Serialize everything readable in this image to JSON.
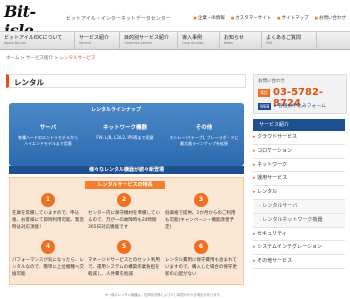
{
  "header": {
    "logo_text": "Bit-isle",
    "logo_sub": "internet data center",
    "tagline": "ビットアイル・インターネットデータセンター",
    "util_nav": [
      "企業・IR情報",
      "カスタマーサイト",
      "サイトマップ",
      "お問い合わせ"
    ]
  },
  "main_nav": [
    {
      "ja": "ビットアイルIDCについて",
      "en": "About Bit-isle"
    },
    {
      "ja": "サービス紹介",
      "en": "Service"
    },
    {
      "ja": "目的別サービス紹介",
      "en": "Objective Search"
    },
    {
      "ja": "導入事例",
      "en": "Case Studies"
    },
    {
      "ja": "お知らせ",
      "en": "News"
    },
    {
      "ja": "よくあるご質問",
      "en": "FAQ"
    }
  ],
  "breadcrumb": {
    "home": "ホーム",
    "sep1": " > ",
    "parent": "サービス紹介",
    "sep2": " > ",
    "current": "レンタルサービス"
  },
  "page_title": "レンタル",
  "lineup": {
    "title": "レンタルラインナップ",
    "columns": [
      {
        "heading": "サーバ",
        "desc": "各種ハードのエントリモデルから\nハイエンドモデルまで用意"
      },
      {
        "heading": "ネットワーク機器",
        "desc": "FW, L/B, L3/L2, IPS等まで用意"
      },
      {
        "heading": "その他",
        "desc": "ストレージ(テープ), プレーラボ・ドに\n最大限ラインナップを拡張"
      }
    ],
    "banner": "様々なレンタル機器が続々新登場"
  },
  "features": {
    "title": "レンタルサービスの特長",
    "items": [
      {
        "num": "1",
        "text": "在庫を常備していますので、申込後、お客様にて即時利用可能、緊急時は対応頂能！"
      },
      {
        "num": "2",
        "text": "センター内に保守機材を準備しているので、万が一の故障時も24時間365日対応機能です"
      },
      {
        "num": "3",
        "text": "低価格で提供。1か月からのご利用も可能(キャンペーン・機能改善予定)"
      },
      {
        "num": "4",
        "text": "パフォーマンスが気になったら、レンタルなので、簡単に上位機種へ交換可能"
      },
      {
        "num": "5",
        "text": "マネージドサービスとのセット利用で、運用システムの構築作業負担を軽減し、人件費を削減"
      },
      {
        "num": "6",
        "text": "レンタル費用に保守費用も含まれていますので、購入した場合の保守更新の心配がない"
      }
    ],
    "footnote": "※一部のレンタル機器は、在庫状況等により少し時間がかかる場合があります。"
  },
  "contact": {
    "label": "お問い合わせ",
    "tel_badge": "電話",
    "tel": "03-5782-8724",
    "web_badge": "WEB",
    "web_link": "各種お申込みフォーム"
  },
  "sidebar": {
    "heading": "サービス紹介",
    "items": [
      {
        "label": "クラウドサービス",
        "sub": false
      },
      {
        "label": "コロケーション",
        "sub": false
      },
      {
        "label": "ネットワーク",
        "sub": false
      },
      {
        "label": "運用サービス",
        "sub": false
      },
      {
        "label": "レンタル",
        "sub": false
      },
      {
        "label": "レンタルサーバ",
        "sub": true
      },
      {
        "label": "レンタルネットワーク機器",
        "sub": true
      },
      {
        "label": "セキュリティ",
        "sub": false
      },
      {
        "label": "システムインテグレーション",
        "sub": false
      },
      {
        "label": "その他サービス",
        "sub": false
      }
    ]
  },
  "colors": {
    "accent": "#e05010",
    "brand_blue": "#1e4f8e",
    "feature_bg": "#fbe6d3"
  }
}
